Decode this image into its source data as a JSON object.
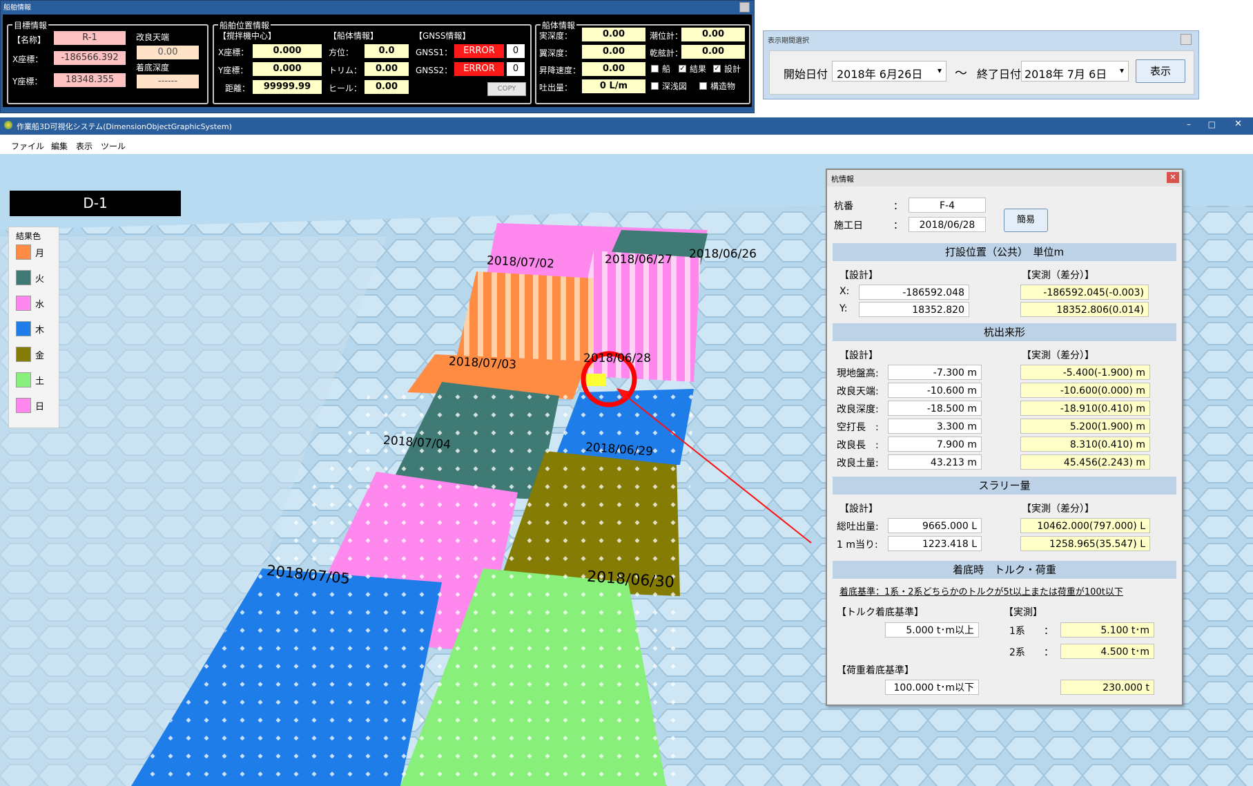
{
  "ship_window": {
    "title": "船舶情報",
    "target": {
      "group_title": "目標情報",
      "name_label": "【名称】",
      "name_value": "R-1",
      "x_label": "X座標：",
      "x_value": "-186566.392",
      "y_label": "Y座標：",
      "y_value": "18348.355",
      "kairyo_label": "改良天端",
      "kairyo_value": "0.00",
      "chakutei_label": "着底深度",
      "chakutei_value": "------"
    },
    "position": {
      "group_title": "船舶位置情報",
      "sub1": "【撹拌機中心】",
      "sub2": "【船体情報】",
      "sub3": "【GNSS情報】",
      "x_label": "X座標：",
      "x_value": "0.000",
      "y_label": "Y座標：",
      "y_value": "0.000",
      "dist_label": "距離：",
      "dist_value": "99999.99",
      "houi_label": "方位：",
      "houi_value": "0.0",
      "trim_label": "トリム：",
      "trim_value": "0.00",
      "heel_label": "ヒール：",
      "heel_value": "0.00",
      "gnss1_label": "GNSS1：",
      "gnss1_value": "ERROR",
      "gnss1_num": "0",
      "gnss2_label": "GNSS2：",
      "gnss2_value": "ERROR",
      "gnss2_num": "0",
      "copy_button": "COPY"
    },
    "body": {
      "group_title": "船体情報",
      "depth_label": "実深度：",
      "depth_value": "0.00",
      "tide_label": "潮位計：",
      "tide_value": "0.00",
      "yoku_label": "翼深度：",
      "yoku_value": "0.00",
      "draft_label": "乾舷計：",
      "draft_value": "0.00",
      "speed_label": "昇降速度：",
      "speed_value": "0.00",
      "flow_label": "吐出量：",
      "flow_value": "0 L/m",
      "chk_ship": "船",
      "chk_result": "結果",
      "chk_design": "設計",
      "chk_depth": "深浅図",
      "chk_struct": "構造物"
    }
  },
  "date_window": {
    "title": "表示期間選択",
    "start_label": "開始日付",
    "start_value": "2018年  6月26日",
    "tilde": "〜",
    "end_label": "終了日付",
    "end_value": "2018年  7月  6日",
    "show_button": "表示"
  },
  "main_window": {
    "title": "作業船3D可視化システム(DimensionObjectGraphicSystem)",
    "menu": [
      "ファイル",
      "編集",
      "表示",
      "ツール"
    ],
    "area_label": "D-1",
    "legend_title": "結果色",
    "legend": [
      {
        "label": "月",
        "color": "#ff8c42"
      },
      {
        "label": "火",
        "color": "#3f7a74"
      },
      {
        "label": "水",
        "color": "#ff88ee"
      },
      {
        "label": "木",
        "color": "#1e7de8"
      },
      {
        "label": "金",
        "color": "#857c05"
      },
      {
        "label": "土",
        "color": "#88f07a"
      },
      {
        "label": "日",
        "color": "#ff88ee"
      }
    ],
    "date_labels": [
      "2018/07/02",
      "2018/06/27",
      "2018/06/26",
      "2018/07/03",
      "2018/06/28",
      "2018/07/04",
      "2018/06/29",
      "2018/07/05",
      "2018/06/30"
    ]
  },
  "pile_panel": {
    "title": "杭情報",
    "pile_no_label": "杭番",
    "pile_no_value": "F-4",
    "date_label": "施工日",
    "date_value": "2018/06/28",
    "colon": "：",
    "simple_button": "簡易",
    "sec1": "打設位置（公共）　単位m",
    "design_head": "【設計】",
    "actual_head": "【実測（差分）】",
    "x_label": "X:",
    "x_design": "-186592.048",
    "x_actual": "-186592.045(-0.003)",
    "y_label": "Y:",
    "y_design": "18352.820",
    "y_actual": "18352.806(0.014)",
    "sec2": "杭出来形",
    "rows": [
      {
        "label": "現地盤高:",
        "design": "-7.300 m",
        "actual": "-5.400(-1.900) m"
      },
      {
        "label": "改良天端:",
        "design": "-10.600 m",
        "actual": "-10.600(0.000) m"
      },
      {
        "label": "改良深度:",
        "design": "-18.500 m",
        "actual": "-18.910(0.410) m"
      },
      {
        "label": "空打長　:",
        "design": "3.300 m",
        "actual": "5.200(1.900) m"
      },
      {
        "label": "改良長　:",
        "design": "7.900 m",
        "actual": "8.310(0.410) m"
      },
      {
        "label": "改良土量:",
        "design": "43.213 m",
        "actual": "45.456(2.243) m"
      }
    ],
    "sec3": "スラリー量",
    "slurry": [
      {
        "label": "総吐出量:",
        "design": "9665.000 L",
        "actual": "10462.000(797.000) L"
      },
      {
        "label": "1 m当り:",
        "design": "1223.418 L",
        "actual": "1258.965(35.547) L"
      }
    ],
    "sec4": "着底時　トルク・荷重",
    "criteria": "着底基準：1系・2系どちらかのトルクが5t以上または荷重が100t以下",
    "torque_head": "【トルク着底基準】",
    "actual_head2": "【実測】",
    "torque_design": "5.000 t･m以上",
    "sys1_label": "1系",
    "sys1_value": "5.100 t･m",
    "sys2_label": "2系",
    "sys2_value": "4.500 t･m",
    "load_head": "【荷重着底基準】",
    "load_design": "100.000 t･m以下",
    "load_actual": "230.000 t"
  }
}
